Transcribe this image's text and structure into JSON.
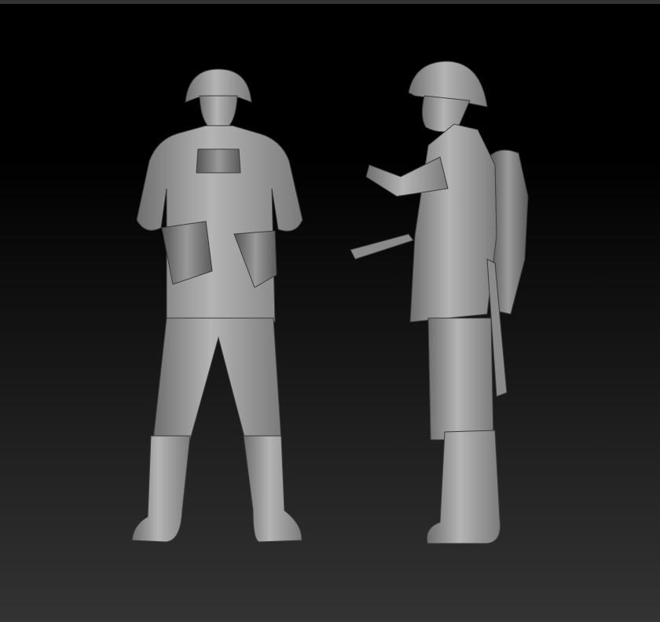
{
  "scene": {
    "background_top": "#000000",
    "background_bottom": "#333333",
    "topbar_color": "#333333",
    "figures": [
      {
        "name": "soldier-front-view"
      },
      {
        "name": "soldier-side-view"
      }
    ]
  }
}
